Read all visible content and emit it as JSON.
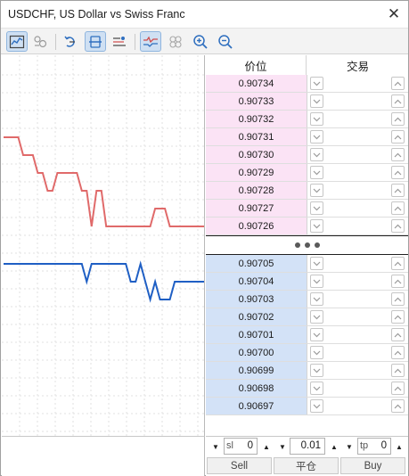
{
  "window": {
    "title": "USDCHF, US Dollar vs Swiss Franc",
    "close_glyph": "✕"
  },
  "toolbar": {
    "buttons": [
      {
        "name": "chart-settings-icon",
        "active": true
      },
      {
        "name": "history-icon",
        "active": false
      },
      {
        "name": "one-click-trading-icon",
        "active": false
      },
      {
        "name": "center-price-icon",
        "active": true
      },
      {
        "name": "columns-settings-icon",
        "active": false
      },
      {
        "name": "tick-chart-icon",
        "active": true
      },
      {
        "name": "volume-circles-icon",
        "active": false
      },
      {
        "name": "zoom-in-icon",
        "active": false
      },
      {
        "name": "zoom-out-icon",
        "active": false
      }
    ]
  },
  "depth": {
    "col_price": "价位",
    "col_trade": "交易",
    "asks": [
      "0.90734",
      "0.90733",
      "0.90732",
      "0.90731",
      "0.90730",
      "0.90729",
      "0.90728",
      "0.90727",
      "0.90726"
    ],
    "bids": [
      "0.90705",
      "0.90704",
      "0.90703",
      "0.90702",
      "0.90701",
      "0.90700",
      "0.90699",
      "0.90698",
      "0.90697"
    ]
  },
  "trade_bar": {
    "sl_label": "sl",
    "sl_value": "0",
    "volume_value": "0.01",
    "tp_label": "tp",
    "tp_value": "0",
    "sell_label": "Sell",
    "close_label": "平仓",
    "buy_label": "Buy"
  },
  "colors": {
    "ask_line": "#e06a6a",
    "bid_line": "#1f5fc4",
    "ask_bg": "#fbe3f5",
    "bid_bg": "#d3e2f7"
  },
  "tick_chart": {
    "ask": [
      0.90731,
      0.90731,
      0.90731,
      0.90731,
      0.9073,
      0.9073,
      0.9073,
      0.90729,
      0.90729,
      0.90728,
      0.90728,
      0.90729,
      0.90729,
      0.90729,
      0.90729,
      0.90729,
      0.90728,
      0.90728,
      0.90726,
      0.90728,
      0.90728,
      0.90726,
      0.90726,
      0.90726,
      0.90726,
      0.90726,
      0.90726,
      0.90726,
      0.90726,
      0.90726,
      0.90726,
      0.90727,
      0.90727,
      0.90727,
      0.90726,
      0.90726,
      0.90726,
      0.90726,
      0.90726,
      0.90726,
      0.90726,
      0.90726
    ],
    "bid": [
      0.90705,
      0.90705,
      0.90705,
      0.90705,
      0.90705,
      0.90705,
      0.90705,
      0.90705,
      0.90705,
      0.90705,
      0.90705,
      0.90705,
      0.90705,
      0.90705,
      0.90705,
      0.90705,
      0.90705,
      0.90704,
      0.90705,
      0.90705,
      0.90705,
      0.90705,
      0.90705,
      0.90705,
      0.90705,
      0.90705,
      0.90704,
      0.90704,
      0.90705,
      0.90704,
      0.90703,
      0.90704,
      0.90703,
      0.90703,
      0.90703,
      0.90704,
      0.90704,
      0.90704,
      0.90704,
      0.90704,
      0.90704,
      0.90704
    ]
  }
}
